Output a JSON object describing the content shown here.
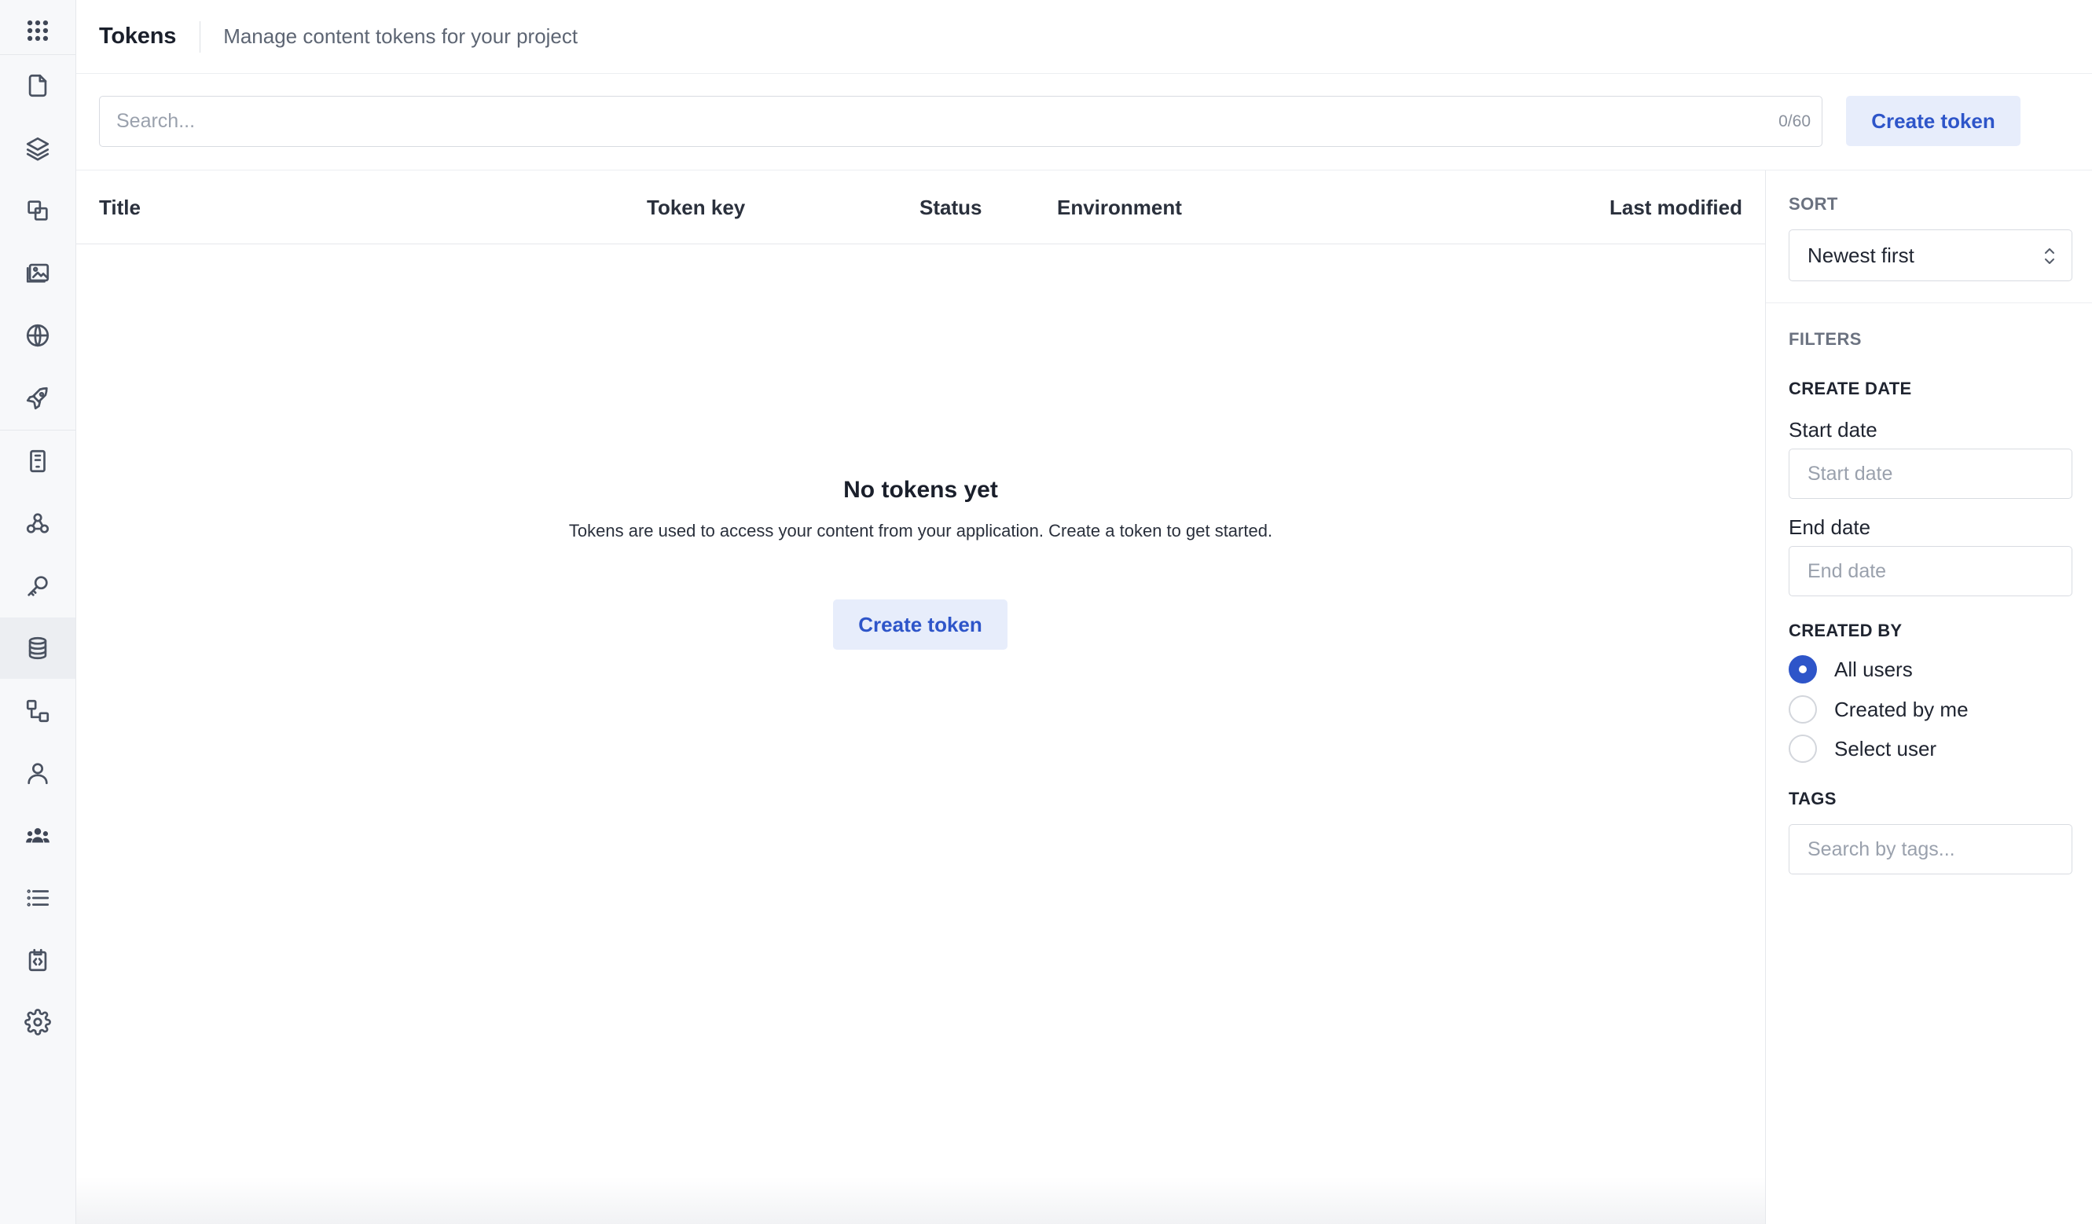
{
  "header": {
    "title": "Tokens",
    "subtitle": "Manage content tokens for your project"
  },
  "toolbar": {
    "search_placeholder": "Search...",
    "char_count": "0/60",
    "create_label": "Create token"
  },
  "table": {
    "columns": [
      "Title",
      "Token key",
      "Status",
      "Environment",
      "Last modified"
    ]
  },
  "empty_state": {
    "title": "No tokens yet",
    "description": "Tokens are used to access your content from your application. Create a token to get started.",
    "button_label": "Create token"
  },
  "panel": {
    "sort_label": "SORT",
    "sort_value": "Newest first",
    "filters_label": "FILTERS",
    "create_date_label": "CREATE DATE",
    "start_date_label": "Start date",
    "start_date_placeholder": "Start date",
    "end_date_label": "End date",
    "end_date_placeholder": "End date",
    "created_by_label": "CREATED BY",
    "created_by_options": [
      "All users",
      "Created by me",
      "Select user"
    ],
    "created_by_selected": "All users",
    "tags_label": "TAGS",
    "tags_placeholder": "Search by tags..."
  },
  "rail": {
    "icons": [
      "apps-grid-icon",
      "file-icon",
      "layers-icon",
      "components-icon",
      "media-icon",
      "globe-icon",
      "rocket-icon",
      "document-icon",
      "webhooks-icon",
      "key-icon",
      "database-icon",
      "workflow-icon",
      "user-icon",
      "team-icon",
      "list-icon",
      "code-icon",
      "settings-icon"
    ],
    "active": "database-icon"
  },
  "colors": {
    "accent": "#2e55c9",
    "accent_bg": "#e7edfb",
    "rail_bg": "#f7f8fa"
  }
}
